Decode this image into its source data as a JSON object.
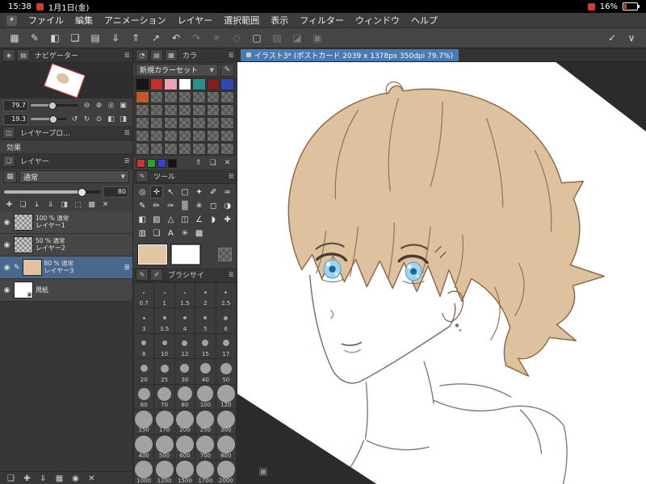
{
  "status_bar": {
    "time": "15:38",
    "date": "1月1日(金)",
    "battery_percent": "16%"
  },
  "menu_bar": {
    "items": [
      "ファイル",
      "編集",
      "アニメーション",
      "レイヤー",
      "選択範囲",
      "表示",
      "フィルター",
      "ウィンドウ",
      "ヘルプ"
    ]
  },
  "toolbar": {
    "left_buttons": [
      {
        "name": "workspace-menu-button",
        "glyph": "▦"
      },
      {
        "name": "pen-settings-button",
        "glyph": "✎"
      },
      {
        "name": "edit-modifier-button",
        "glyph": "◧"
      },
      {
        "name": "new-file-button",
        "glyph": "❏"
      },
      {
        "name": "open-file-button",
        "glyph": "▤"
      },
      {
        "name": "save-button",
        "glyph": "⇓"
      },
      {
        "name": "export-button",
        "glyph": "⇑"
      },
      {
        "name": "share-button",
        "glyph": "↗"
      },
      {
        "name": "undo-button",
        "glyph": "↶"
      },
      {
        "name": "redo-button",
        "glyph": "↷",
        "disabled": true
      },
      {
        "name": "correction-button",
        "glyph": "✳",
        "disabled": true
      },
      {
        "name": "snap-button",
        "glyph": "◇",
        "disabled": true
      },
      {
        "name": "frame-button",
        "glyph": "▢"
      },
      {
        "name": "select-layer-button",
        "glyph": "▨",
        "disabled": true
      },
      {
        "name": "mask-button",
        "glyph": "◪",
        "disabled": true
      },
      {
        "name": "onion-skin-button",
        "glyph": "▣",
        "disabled": true
      }
    ],
    "right_buttons": [
      {
        "name": "tool-check-button",
        "glyph": "✓"
      },
      {
        "name": "collapse-toolbar-button",
        "glyph": "∨"
      }
    ]
  },
  "document_tab": {
    "title": "イラスト3* (ポストカード 2039 x 1378px 350dpi 79.7%)"
  },
  "navigator": {
    "title": "ナビゲーター",
    "header_icons": [
      {
        "name": "navigator-tab-icon",
        "glyph": "◈"
      },
      {
        "name": "subview-tab-icon",
        "glyph": "▤"
      }
    ],
    "zoom_value": "79.7",
    "rotate_value": "19.3",
    "zoom_buttons": [
      {
        "name": "zoom-out-button",
        "glyph": "⊖"
      },
      {
        "name": "zoom-in-button",
        "glyph": "⊕"
      },
      {
        "name": "zoom-reset-button",
        "glyph": "◎"
      },
      {
        "name": "fit-to-screen-button",
        "glyph": "▣"
      }
    ],
    "rotate_buttons": [
      {
        "name": "rotate-left-button",
        "glyph": "↺"
      },
      {
        "name": "rotate-right-button",
        "glyph": "↻"
      },
      {
        "name": "rotate-reset-button",
        "glyph": "⊙"
      },
      {
        "name": "flip-horizontal-button",
        "glyph": "◧"
      },
      {
        "name": "flip-vertical-button",
        "glyph": "◨"
      }
    ]
  },
  "layer_property": {
    "title": "レイヤープロ...",
    "effect_label": "効果",
    "header_icons": [
      {
        "name": "layer-property-tab-icon",
        "glyph": "◫"
      }
    ]
  },
  "layer_panel": {
    "title": "レイヤー",
    "header_icons": [
      {
        "name": "layer-tab-icon",
        "glyph": "❏"
      }
    ],
    "blend_mode": "通常",
    "opacity_value": "80",
    "row_icons": {
      "visibility": "◉",
      "editing": "✎",
      "menu": "≣",
      "paper": "▣"
    },
    "action_icons": [
      {
        "name": "new-layer-button",
        "glyph": "✚"
      },
      {
        "name": "new-folder-button",
        "glyph": "❏"
      },
      {
        "name": "transfer-down-button",
        "glyph": "↓"
      },
      {
        "name": "merge-down-button",
        "glyph": "⇓"
      },
      {
        "name": "layer-mask-button",
        "glyph": "◨"
      },
      {
        "name": "clipping-button",
        "glyph": "⬚"
      },
      {
        "name": "lock-button",
        "glyph": "▩"
      },
      {
        "name": "delete-layer-button",
        "glyph": "✕"
      }
    ],
    "layers": [
      {
        "opacity": "100 %",
        "blend": "通常",
        "name": "レイヤー1",
        "thumb": "checker"
      },
      {
        "opacity": "50 %",
        "blend": "通常",
        "name": "レイヤー2",
        "thumb": "checker"
      },
      {
        "opacity": "80 %",
        "blend": "通常",
        "name": "レイヤー3",
        "thumb": "color",
        "thumb_color": "#dfc2a0",
        "selected": true,
        "editing": true
      },
      {
        "opacity": "",
        "blend": "",
        "name": "用紙",
        "thumb": "paper"
      }
    ],
    "bottom_icons": [
      {
        "name": "bottom-new-folder-button",
        "glyph": "❏"
      },
      {
        "name": "bottom-new-layer-button",
        "glyph": "✚"
      },
      {
        "name": "bottom-transfer-button",
        "glyph": "⇓"
      },
      {
        "name": "bottom-grid-button",
        "glyph": "▦"
      },
      {
        "name": "bottom-record-button",
        "glyph": "◉"
      },
      {
        "name": "bottom-delete-button",
        "glyph": "✕"
      }
    ]
  },
  "color_panel": {
    "title": "カラ",
    "header_icons": [
      {
        "name": "color-wheel-tab-icon",
        "glyph": "◔"
      },
      {
        "name": "color-slider-tab-icon",
        "glyph": "▤"
      },
      {
        "name": "color-set-tab-icon",
        "glyph": "▦"
      }
    ],
    "set_name": "新規カラーセット",
    "set_edit_icon": {
      "name": "edit-color-set-icon",
      "glyph": "✎"
    },
    "palette": [
      "#161616",
      "#c23028",
      "#eaa2b4",
      "#ffffff",
      "#2e8f8a",
      "#7e2020",
      "#2e49b5",
      "#c25a28",
      "T",
      "T",
      "T",
      "T",
      "T",
      "T",
      "T",
      "T",
      "T",
      "T",
      "T",
      "T",
      "T",
      "T",
      "T",
      "T",
      "T",
      "T",
      "T",
      "T",
      "T",
      "T",
      "T",
      "T",
      "T",
      "T",
      "T",
      "T",
      "T",
      "T",
      "T",
      "T",
      "T",
      "T"
    ],
    "quick_colors": [
      "#cc3333",
      "#2fa12f",
      "#3344cc",
      "#141414"
    ],
    "footer_icons": [
      {
        "name": "palette-export-icon",
        "glyph": "⇑"
      },
      {
        "name": "palette-folder-icon",
        "glyph": "❏"
      },
      {
        "name": "palette-delete-icon",
        "glyph": "✕"
      }
    ]
  },
  "tool_panel": {
    "title": "ツール",
    "header_icons": [
      {
        "name": "tool-tab-icon",
        "glyph": "✎"
      }
    ],
    "main_color": "#e3c6a4",
    "sub_color": "#ffffff",
    "tools": [
      {
        "name": "zoom-tool",
        "glyph": "◎"
      },
      {
        "name": "move-tool",
        "glyph": "✛",
        "selected": true
      },
      {
        "name": "operation-tool",
        "glyph": "↖"
      },
      {
        "name": "selection-tool",
        "glyph": "▢"
      },
      {
        "name": "auto-select-tool",
        "glyph": "✦"
      },
      {
        "name": "eyedropper-tool",
        "glyph": "✐"
      },
      {
        "name": "line-correction-tool",
        "glyph": "≈"
      },
      {
        "name": "pen-tool",
        "glyph": "✎"
      },
      {
        "name": "pencil-tool",
        "glyph": "✏"
      },
      {
        "name": "brush-tool",
        "glyph": "✑"
      },
      {
        "name": "airbrush-tool",
        "glyph": "▒"
      },
      {
        "name": "decoration-tool",
        "glyph": "✳"
      },
      {
        "name": "eraser-tool",
        "glyph": "◻"
      },
      {
        "name": "blend-tool",
        "glyph": "◑"
      },
      {
        "name": "fill-tool",
        "glyph": "◧"
      },
      {
        "name": "gradient-tool",
        "glyph": "▨"
      },
      {
        "name": "figure-tool",
        "glyph": "△"
      },
      {
        "name": "frame-border-tool",
        "glyph": "◫"
      },
      {
        "name": "ruler-tool",
        "glyph": "∠"
      },
      {
        "name": "balloon-tool",
        "glyph": "◗"
      },
      {
        "name": "correction-tool",
        "glyph": "✚"
      },
      {
        "name": "tone-tool",
        "glyph": "▥"
      },
      {
        "name": "material-tool",
        "glyph": "❏"
      },
      {
        "name": "text-tool",
        "glyph": "A"
      },
      {
        "name": "effect-tool",
        "glyph": "✳"
      },
      {
        "name": "pattern-tool",
        "glyph": "▩"
      }
    ]
  },
  "brush_panel": {
    "title": "ブラシサイ",
    "header_icons": [
      {
        "name": "brush-tab-icon-1",
        "glyph": "✎"
      },
      {
        "name": "brush-tab-icon-2",
        "glyph": "✐"
      }
    ],
    "sizes": [
      "0.7",
      "1",
      "1.5",
      "2",
      "2.5",
      "3",
      "3.5",
      "4",
      "5",
      "6",
      "8",
      "10",
      "12",
      "15",
      "17",
      "20",
      "25",
      "30",
      "40",
      "50",
      "60",
      "70",
      "80",
      "100",
      "120",
      "150",
      "170",
      "200",
      "250",
      "300",
      "400",
      "500",
      "600",
      "700",
      "800",
      "1000",
      "1200",
      "1500",
      "1700",
      "2000"
    ]
  }
}
